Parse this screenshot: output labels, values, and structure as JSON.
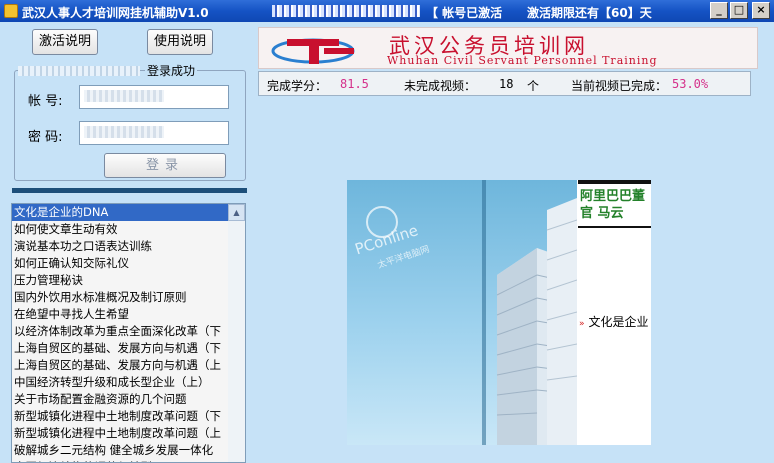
{
  "titlebar": {
    "title": "武汉人事人才培训网挂机辅助V1.0",
    "account_status": "【 帐号已激活",
    "expiry": "激活期限还有【60】天",
    "minimize_label": "_",
    "maximize_label": "□",
    "close_label": "×"
  },
  "sidebar": {
    "activate_button": "激活说明",
    "usage_button": "使用说明",
    "login_status": "登录成功",
    "account_label": "帐  号:",
    "password_label": "密  码:",
    "login_button": "登录"
  },
  "course_list": {
    "scroll_up_glyph": "▲",
    "items": [
      "文化是企业的DNA",
      "如何使文章生动有效",
      "演说基本功之口语表达训练",
      "如何正确认知交际礼仪",
      "压力管理秘诀",
      "国内外饮用水标准概况及制订原则",
      "在绝望中寻找人生希望",
      "以经济体制改革为重点全面深化改革（下",
      "上海自贸区的基础、发展方向与机遇（下",
      "上海自贸区的基础、发展方向与机遇（上",
      "中国经济转型升级和成长型企业（上）",
      "关于市场配置金融资源的几个问题",
      "新型城镇化进程中土地制度改革问题（下",
      "新型城镇化进程中土地制度改革问题（上",
      "破解城乡二元结构  健全城乡发展一体化",
      "中国经济结构的调整与转型"
    ]
  },
  "banner": {
    "cn_name": "武汉公务员培训网",
    "en_name": "Whuhan Civil Servant Personnel Training"
  },
  "stats": {
    "credits_label": "完成学分：",
    "credits_value": "81.5",
    "unfinished_label": "未完成视频：",
    "unfinished_value": "18",
    "unfinished_unit": "个",
    "progress_label": "当前视频已完成：",
    "progress_value": "53.0%"
  },
  "video": {
    "headline_line1": "阿里巴巴董",
    "headline_line2": "官 马云",
    "now_playing": "文化是企业",
    "watermark_main": "PConline",
    "watermark_sub": "太平洋电脑网"
  },
  "colors": {
    "background": "#c6e2f7",
    "titlebar": "#1553c4",
    "brand_red": "#c8102e",
    "stat_value": "#d5318b",
    "selection": "#3169c6"
  }
}
